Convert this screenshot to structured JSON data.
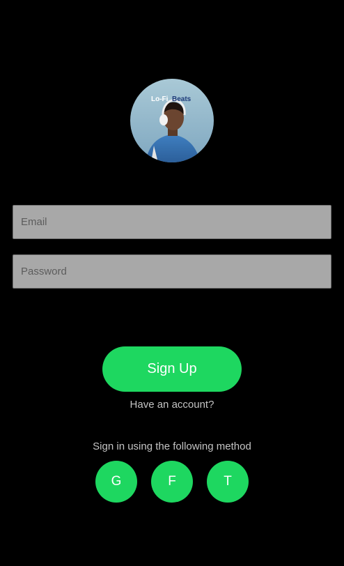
{
  "avatar": {
    "title_part1": "Lo-Fi",
    "title_part2": "Beats"
  },
  "form": {
    "email_placeholder": "Email",
    "password_placeholder": "Password",
    "signup_label": "Sign Up",
    "have_account_label": "Have an account?"
  },
  "social": {
    "heading": "Sign in using the following method",
    "google_label": "G",
    "facebook_label": "F",
    "twitter_label": "T"
  },
  "colors": {
    "background": "#000000",
    "accent": "#1ed760",
    "field_background": "#a8a8a8",
    "secondary_text": "#c4c4c4"
  },
  "icons": [
    "lofi-beats-cover-image"
  ]
}
